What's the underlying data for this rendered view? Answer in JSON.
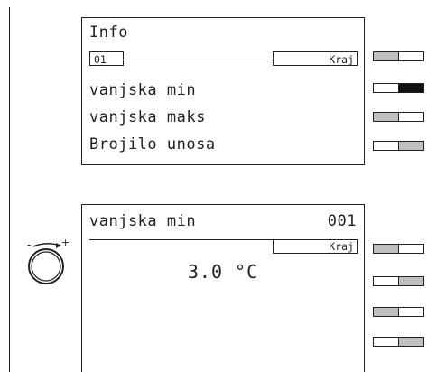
{
  "screen1": {
    "title": "Info",
    "index": "01",
    "back_label": "Kraj",
    "items": [
      "vanjska min",
      "vanjska maks",
      "Brojilo unosa"
    ]
  },
  "screen2": {
    "title": "vanjska min",
    "code": "001",
    "back_label": "Kraj",
    "value": "3.0 °C"
  },
  "knob": {
    "minus": "-",
    "plus": "+"
  },
  "softkeys": {
    "top": [
      {
        "left": "grey",
        "right": "white"
      },
      {
        "left": "white",
        "right": "black"
      },
      {
        "left": "grey",
        "right": "white"
      },
      {
        "left": "white",
        "right": "grey"
      }
    ],
    "bottom": [
      {
        "left": "grey",
        "right": "white"
      },
      {
        "left": "white",
        "right": "grey"
      },
      {
        "left": "grey",
        "right": "white"
      },
      {
        "left": "white",
        "right": "grey"
      }
    ]
  },
  "colors": {
    "line": "#222222",
    "key_grey": "#bfbfbf",
    "key_black": "#111111"
  }
}
